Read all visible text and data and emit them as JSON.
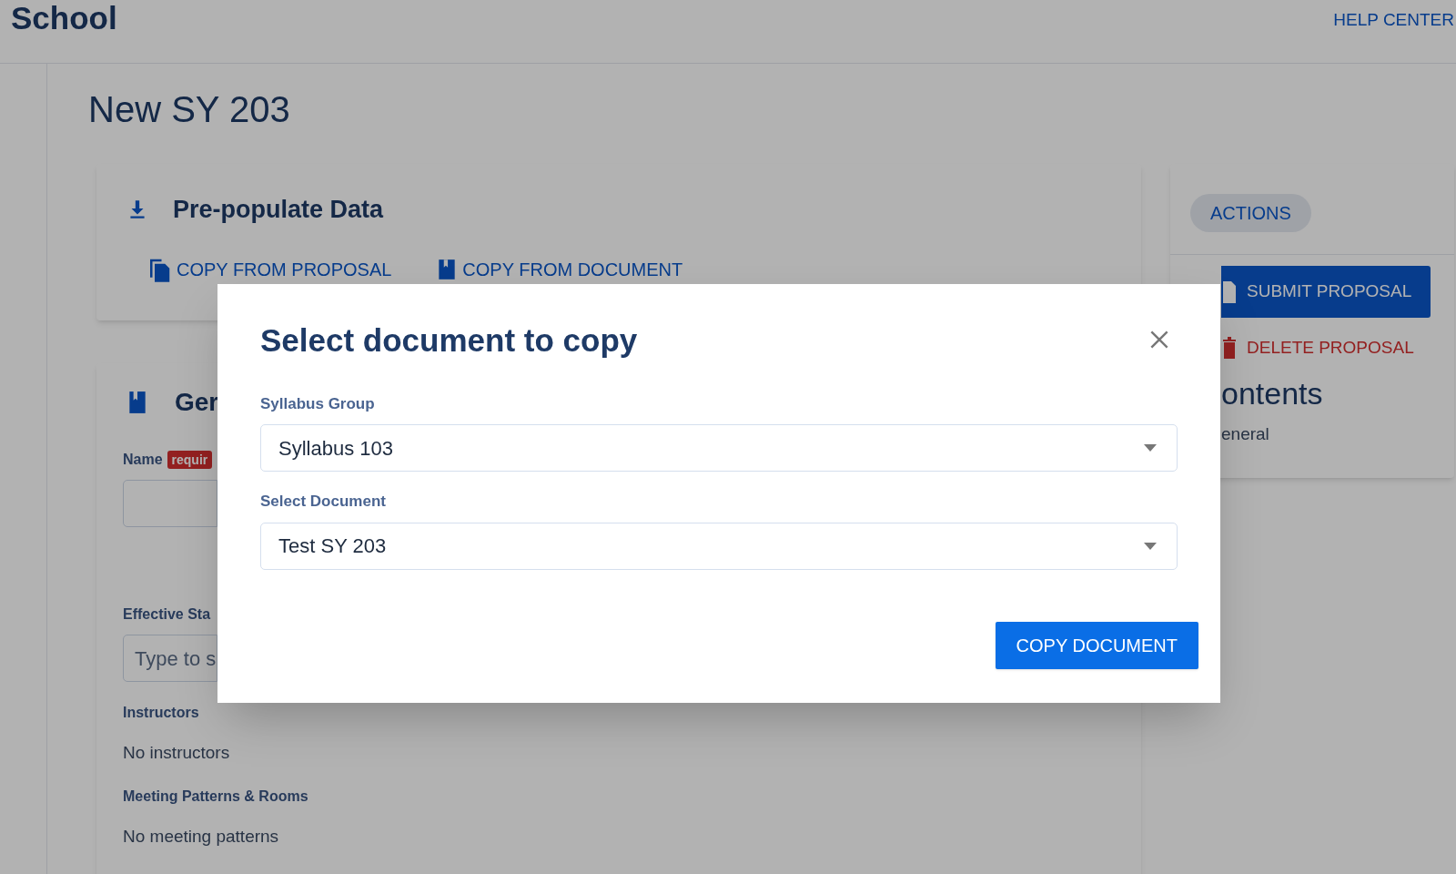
{
  "header": {
    "brand": "School",
    "help_link": "HELP CENTER"
  },
  "page_title": "New SY 203",
  "prepopulate": {
    "title": "Pre-populate Data",
    "links": [
      "COPY FROM PROPOSAL",
      "COPY FROM DOCUMENT"
    ]
  },
  "general": {
    "title": "Ger",
    "fields": [
      {
        "kind": "input",
        "label": "Name",
        "badge": "requir"
      },
      {
        "kind": "input",
        "label": "Effective Sta",
        "placeholder": "Type to s"
      },
      {
        "kind": "list",
        "label": "Instructors",
        "empty": "No instructors"
      },
      {
        "kind": "list",
        "label": "Meeting Patterns & Rooms",
        "empty": "No meeting patterns"
      }
    ]
  },
  "actions": {
    "tab": "ACTIONS",
    "buttons": [
      {
        "kind": "primary",
        "label": "SUBMIT PROPOSAL"
      },
      {
        "kind": "danger",
        "label": "DELETE PROPOSAL"
      }
    ],
    "contents_title": "ontents",
    "contents_items": [
      "eneral"
    ]
  },
  "modal": {
    "title": "Select document to copy",
    "fields": [
      {
        "label": "Syllabus Group",
        "value": "Syllabus 103"
      },
      {
        "label": "Select Document",
        "value": "Test SY 203"
      }
    ],
    "button": "COPY DOCUMENT"
  }
}
